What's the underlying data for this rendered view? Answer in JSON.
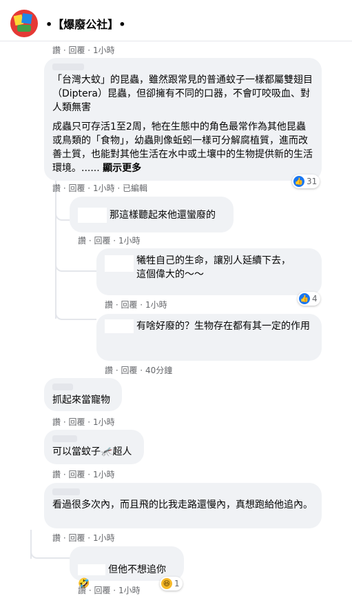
{
  "header": {
    "title": "•【爆廢公社】•"
  },
  "actions_prefix": {
    "like": "讚",
    "reply": "回覆"
  },
  "top_actions": {
    "time": "1小時"
  },
  "comments": [
    {
      "text_p1": "「台灣大蚊」的昆蟲，雖然跟常見的普通蚊子一樣都屬雙翅目（Diptera）昆蟲，但卻擁有不同的口器，不會叮咬吸血、對人類無害",
      "text_p2": "成蟲只可存活1至2周，牠在生態中的角色最常作為其他昆蟲或鳥類的「食物」，幼蟲則像蚯蚓一樣可分解腐植質，進而改善土質，也能對其他生活在水中或土壤中的生物提供新的生活環境。......",
      "see_more": "顯示更多",
      "time": "1小時",
      "edited": "已編輯",
      "reactions": "31",
      "replies": [
        {
          "text": "那這樣聽起來他還蠻廢的",
          "time": "1小時"
        },
        {
          "text": "犧牲自己的生命，讓別人延續下去，這個偉大的～～",
          "time": "1小時",
          "reactions": "4"
        },
        {
          "text": "有啥好廢的？生物存在都有其一定的作用",
          "time": "40分鐘"
        }
      ]
    },
    {
      "text": "抓起來當寵物",
      "time": "1小時"
    },
    {
      "text": "可以當蚊子",
      "text_after": "超人",
      "time": "1小時"
    },
    {
      "text": "看過很多次內，而且飛的比我走路還慢內，真想跑給他追內。",
      "time": "1小時",
      "replies": [
        {
          "text": "但他不想追你",
          "time": "1小時",
          "reactions": "1"
        }
      ]
    }
  ]
}
